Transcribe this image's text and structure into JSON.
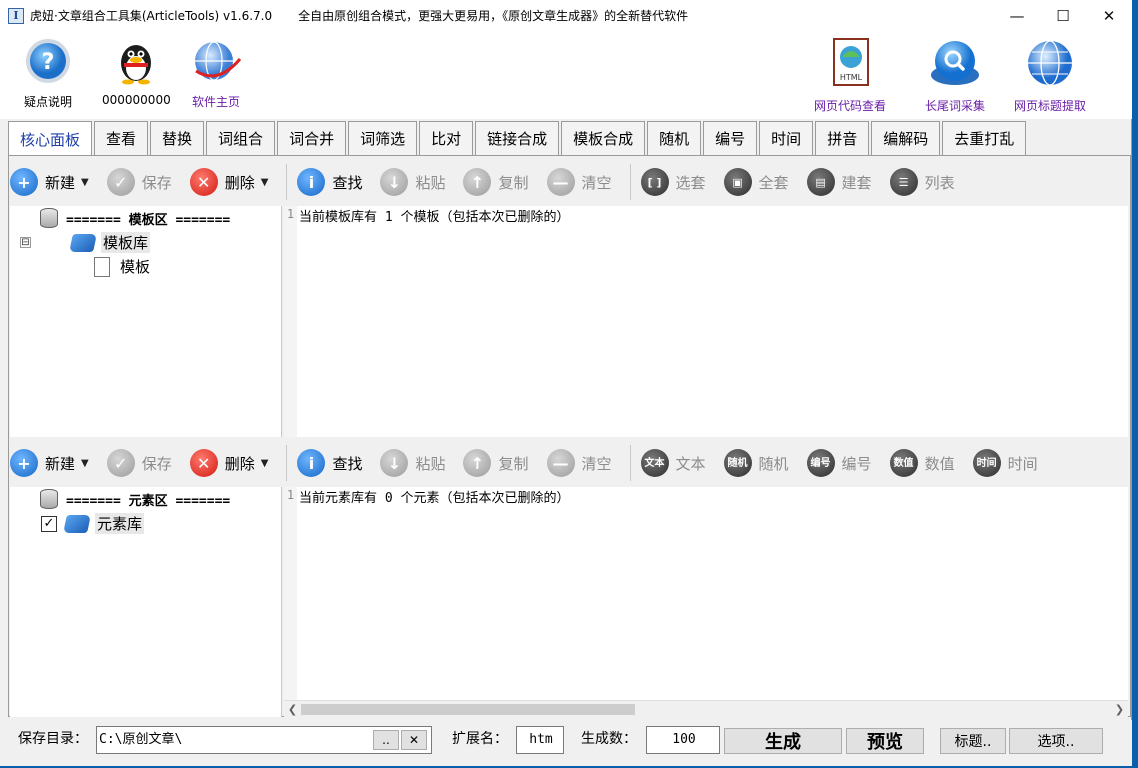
{
  "window": {
    "title": "虎妞·文章组合工具集(ArticleTools) v1.6.7.0",
    "slogan": "全自由原创组合模式，更强大更易用，《原创文章生成器》的全新替代软件",
    "controls": {
      "minimize": "—",
      "maximize": "☐",
      "close": "✕"
    }
  },
  "top_tools": [
    {
      "label": "疑点说明",
      "icon": "help-icon"
    },
    {
      "label": "000000000",
      "icon": "qq-penguin-icon"
    },
    {
      "label": "软件主页",
      "icon": "globe-icon"
    },
    {
      "label": "网页代码查看",
      "icon": "html-page-icon"
    },
    {
      "label": "长尾词采集",
      "icon": "search-icon"
    },
    {
      "label": "网页标题提取",
      "icon": "web-globe-icon"
    }
  ],
  "tabs": [
    "核心面板",
    "查看",
    "替换",
    "词组合",
    "词合并",
    "词筛选",
    "比对",
    "链接合成",
    "模板合成",
    "随机",
    "编号",
    "时间",
    "拼音",
    "编解码",
    "去重打乱"
  ],
  "active_tab": "核心面板",
  "template_toolbar": {
    "new": "新建",
    "save": "保存",
    "delete": "删除",
    "find": "查找",
    "paste": "粘贴",
    "copy": "复制",
    "clear": "清空",
    "select_set": "选套",
    "full_set": "全套",
    "build_set": "建套",
    "list_table": "列表"
  },
  "element_toolbar": {
    "new": "新建",
    "save": "保存",
    "delete": "删除",
    "find": "查找",
    "paste": "粘贴",
    "copy": "复制",
    "clear": "清空",
    "text": "文本",
    "random": "随机",
    "numbering": "编号",
    "value": "数值",
    "time": "时间",
    "text_glyph": "文本",
    "random_glyph": "随机",
    "numbering_glyph": "编号",
    "value_glyph": "数值",
    "time_glyph": "时间"
  },
  "template_tree": {
    "header": "=======  模板区  =======",
    "library": "模板库",
    "child": "模板",
    "expand_glyph": "⊟"
  },
  "template_editor": {
    "line": "1",
    "text": "当前模板库有 1 个模板（包括本次已删除的）"
  },
  "element_tree": {
    "header": "=======  元素区  =======",
    "library": "元素库",
    "checked": "✓"
  },
  "element_editor": {
    "line": "1",
    "text": "当前元素库有 0 个元素（包括本次已删除的）"
  },
  "bottom": {
    "save_dir_label": "保存目录：",
    "save_dir_value": "C:\\原创文章\\",
    "browse": "..",
    "clear": "✕",
    "ext_label": "扩展名：",
    "ext_value": "htm",
    "count_label": "生成数：",
    "count_value": "100",
    "generate": "生成",
    "preview": "预览",
    "title_btn": "标题..",
    "options_btn": "选项.."
  }
}
